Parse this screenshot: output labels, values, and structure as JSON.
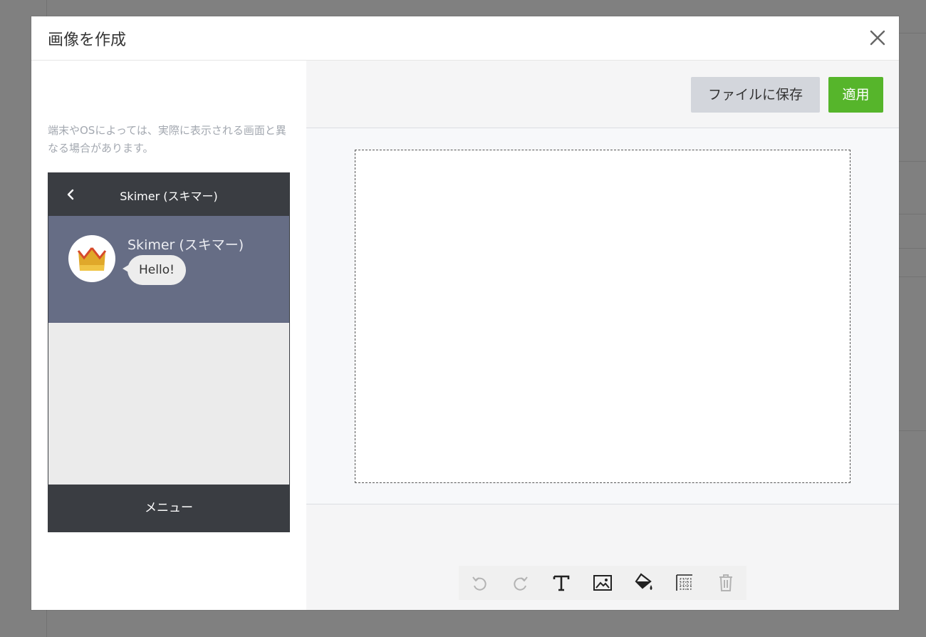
{
  "modal": {
    "title": "画像を作成"
  },
  "left": {
    "notice": "端末やOSによっては、実際に表示される画面と異なる場合があります。"
  },
  "phone": {
    "header_title": "Skimer (スキマー)",
    "sender_name": "Skimer (スキマー)",
    "message": "Hello!",
    "menu_label": "メニュー"
  },
  "toolbar": {
    "save_label": "ファイルに保存",
    "apply_label": "適用"
  },
  "tools": [
    {
      "name": "undo-icon"
    },
    {
      "name": "redo-icon"
    },
    {
      "name": "text-icon"
    },
    {
      "name": "image-icon"
    },
    {
      "name": "fill-icon"
    },
    {
      "name": "grid-icon"
    },
    {
      "name": "trash-icon"
    }
  ],
  "colors": {
    "apply_button": "#56b52b",
    "save_button": "#d3d6dc",
    "phone_header": "#3a3d42",
    "chat_background": "#666d85"
  }
}
